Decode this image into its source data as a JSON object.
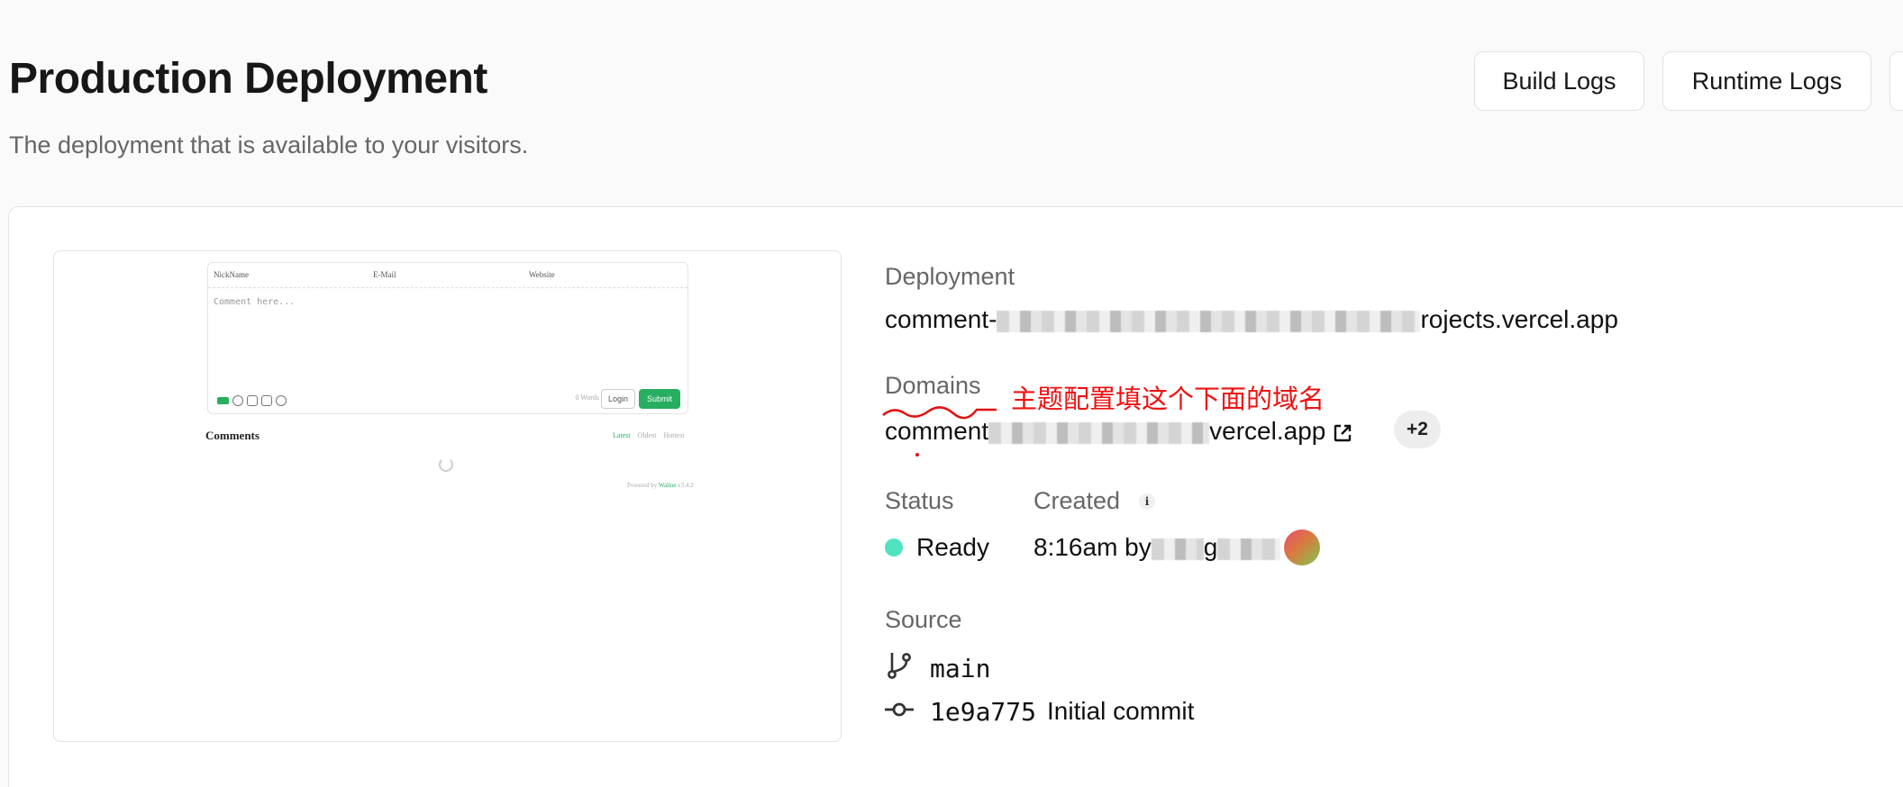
{
  "header": {
    "title": "Production Deployment",
    "subtitle": "The deployment that is available to your visitors.",
    "buttons": {
      "build_logs": "Build Logs",
      "runtime_logs": "Runtime Logs"
    }
  },
  "preview": {
    "fields": [
      "NickName",
      "E-Mail",
      "Website"
    ],
    "placeholder": "Comment here...",
    "md_badge": "MD",
    "words": "0 Words",
    "login": "Login",
    "submit": "Submit",
    "comments_title": "Comments",
    "sort": [
      "Latest",
      "Oldest",
      "Hottest"
    ],
    "powered_prefix": "Powered by",
    "powered_brand": "Waline",
    "powered_version": "v3.4.2"
  },
  "details": {
    "deployment_label": "Deployment",
    "deployment_prefix": "comment-",
    "deployment_suffix": "rojects.vercel.app",
    "domains_label": "Domains",
    "domain_prefix": "comment",
    "domain_suffix": "vercel.app",
    "domains_more": "+2",
    "annotation": "主题配置填这个下面的域名",
    "status_label": "Status",
    "status_value": "Ready",
    "created_label": "Created",
    "created_time": "8:16am by",
    "created_user_fragment": "g",
    "source_label": "Source",
    "branch": "main",
    "commit_hash": "1e9a775",
    "commit_message": "Initial commit"
  },
  "colors": {
    "status_ready": "#50e3c2",
    "annotation_red": "#e11111",
    "waline_green": "#27ae60"
  }
}
